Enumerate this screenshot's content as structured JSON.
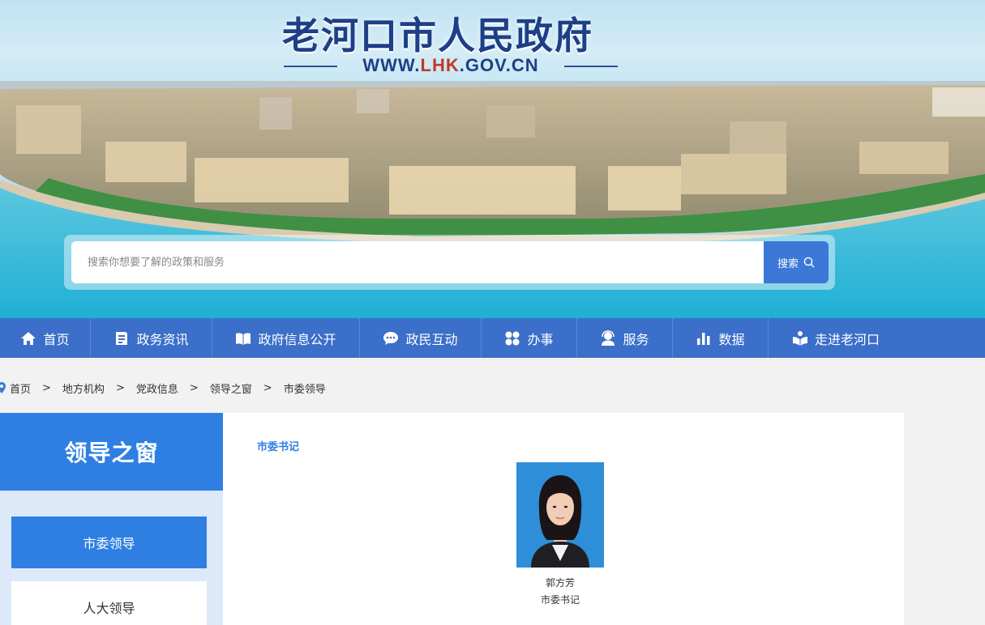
{
  "header": {
    "site_title": "老河口市人民政府",
    "site_url_pre": "WWW.",
    "site_url_hl": "LHK",
    "site_url_post": ".GOV.CN"
  },
  "search": {
    "placeholder": "搜索你想要了解的政策和服务",
    "button_label": "搜索"
  },
  "nav": {
    "items": [
      {
        "label": "首页",
        "icon": "home-icon"
      },
      {
        "label": "政务资讯",
        "icon": "news-icon"
      },
      {
        "label": "政府信息公开",
        "icon": "book-icon"
      },
      {
        "label": "政民互动",
        "icon": "chat-icon"
      },
      {
        "label": "办事",
        "icon": "grid-icon"
      },
      {
        "label": "服务",
        "icon": "service-icon"
      },
      {
        "label": "数据",
        "icon": "chart-icon"
      },
      {
        "label": "走进老河口",
        "icon": "reader-icon"
      }
    ]
  },
  "breadcrumb": [
    "首页",
    "地方机构",
    "党政信息",
    "领导之窗",
    "市委领导"
  ],
  "breadcrumb_separator": ">",
  "sidebar": {
    "title": "领导之窗",
    "items": [
      {
        "label": "市委领导",
        "active": true
      },
      {
        "label": "人大领导",
        "active": false
      }
    ]
  },
  "content": {
    "section_title": "市委书记",
    "leader": {
      "name": "郭方芳",
      "title": "市委书记"
    }
  },
  "colors": {
    "nav_bg": "#3b6fc9",
    "accent": "#2f7fe3",
    "title_blue": "#1d3f86"
  }
}
